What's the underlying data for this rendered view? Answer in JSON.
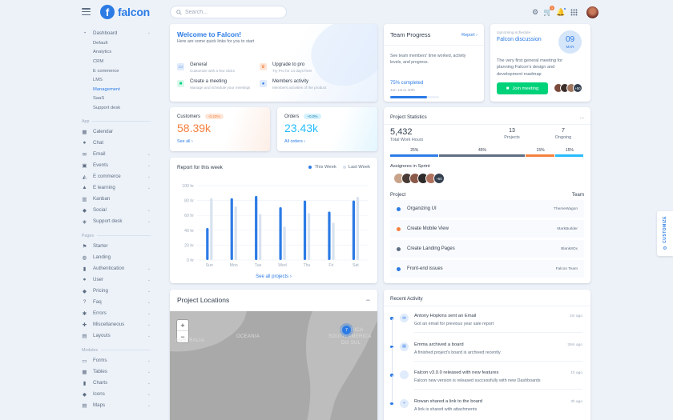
{
  "header": {
    "logo": "falcon",
    "search_placeholder": "Search...",
    "cart_count": "1"
  },
  "sidebar": {
    "dashboard": {
      "label": "Dashboard",
      "children": [
        "Default",
        "Analytics",
        "CRM",
        "E commerce",
        "LMS",
        "Management",
        "SaaS",
        "Support desk"
      ],
      "active_index": 5
    },
    "app_label": "App",
    "app": [
      {
        "label": "Calendar",
        "icon": "calendar-icon",
        "chevron": false
      },
      {
        "label": "Chat",
        "icon": "chat-icon",
        "chevron": false
      },
      {
        "label": "Email",
        "icon": "envelope-icon",
        "chevron": true
      },
      {
        "label": "Events",
        "icon": "calendar-day-icon",
        "chevron": true
      },
      {
        "label": "E commerce",
        "icon": "cart-icon",
        "chevron": true
      },
      {
        "label": "E learning",
        "icon": "graduation-cap-icon",
        "chevron": true
      },
      {
        "label": "Kanban",
        "icon": "kanban-icon",
        "chevron": false
      },
      {
        "label": "Social",
        "icon": "share-icon",
        "chevron": true
      },
      {
        "label": "Support desk",
        "icon": "ticket-icon",
        "chevron": true
      }
    ],
    "pages_label": "Pages",
    "pages": [
      {
        "label": "Starter",
        "icon": "flag-icon",
        "chevron": false
      },
      {
        "label": "Landing",
        "icon": "globe-icon",
        "chevron": false
      },
      {
        "label": "Authentication",
        "icon": "lock-icon",
        "chevron": true
      },
      {
        "label": "User",
        "icon": "user-icon",
        "chevron": true
      },
      {
        "label": "Pricing",
        "icon": "tag-icon",
        "chevron": true
      },
      {
        "label": "Faq",
        "icon": "question-icon",
        "chevron": true
      },
      {
        "label": "Errors",
        "icon": "bug-icon",
        "chevron": true
      },
      {
        "label": "Miscellaneous",
        "icon": "puzzle-icon",
        "chevron": true
      },
      {
        "label": "Layouts",
        "icon": "layout-icon",
        "chevron": true
      }
    ],
    "modules_label": "Modules",
    "modules": [
      {
        "label": "Forms",
        "icon": "file-icon",
        "chevron": true
      },
      {
        "label": "Tables",
        "icon": "table-icon",
        "chevron": true
      },
      {
        "label": "Charts",
        "icon": "chart-icon",
        "chevron": true
      },
      {
        "label": "Icons",
        "icon": "shapes-icon",
        "chevron": true
      },
      {
        "label": "Maps",
        "icon": "map-icon",
        "chevron": true
      }
    ]
  },
  "welcome": {
    "title": "Welcome to Falcon!",
    "subtitle": "Here are some quick links for you to start",
    "links": [
      {
        "title": "General",
        "sub": "Customize with a few clicks",
        "color": "#2c7be5",
        "bg": "#e0ebfb",
        "icon": "doc-icon"
      },
      {
        "title": "Upgrade to pro",
        "sub": "Try Pro for 14 days free!",
        "color": "#f5803e",
        "bg": "#fde6d8",
        "icon": "crown-icon"
      },
      {
        "title": "Create a meeting",
        "sub": "Manage and schedule your meetings",
        "color": "#00d27a",
        "bg": "#d9f8eb",
        "icon": "video-icon"
      },
      {
        "title": "Members activity",
        "sub": "Members activities of the product",
        "color": "#2c7be5",
        "bg": "#e0ebfb",
        "icon": "users-icon"
      }
    ]
  },
  "team_progress": {
    "title": "Team Progress",
    "report_link": "Report",
    "description": "See team members' time worked, activity levels, and progress.",
    "progress": 0.75,
    "completed": "75% completed",
    "date": "Jan 1st to 30th"
  },
  "upcoming": {
    "label": "Upcoming schedule",
    "title": "Falcon discussion",
    "day": "09",
    "month": "MAR",
    "description": "The very first general meeting for planning Falcon's design and development roadmap",
    "button": "Join meeting",
    "more": "+50"
  },
  "customers": {
    "label": "Customers",
    "change": "-0.23%",
    "value": "58.39k",
    "link": "See all",
    "color": "#f5803e"
  },
  "orders": {
    "label": "Orders",
    "change": "+0.0%",
    "value": "23.43k",
    "link": "All orders",
    "color": "#27bcfd"
  },
  "report": {
    "title": "Report for this week",
    "link": "See all projects",
    "this_week_color": "#2c7be5",
    "last_week_color": "#d8e2ef"
  },
  "chart_data": {
    "type": "bar",
    "title": "Report for this week",
    "categories": [
      "Sun",
      "Mon",
      "Tue",
      "Wed",
      "Thu",
      "Fri",
      "Sat"
    ],
    "y_ticks": [
      "100 hr",
      "80 hr",
      "60 hr",
      "40 hr",
      "20 hr",
      "0 hr"
    ],
    "ylim": [
      0,
      100
    ],
    "series": [
      {
        "name": "This Week",
        "values": [
          43,
          83,
          86,
          71,
          80,
          65,
          80
        ]
      },
      {
        "name": "Last Week",
        "values": [
          83,
          72,
          62,
          45,
          63,
          50,
          85
        ]
      }
    ]
  },
  "project_stats": {
    "title": "Project Statistics",
    "menu": "...",
    "total": "5,432",
    "total_label": "Total Work Hours",
    "projects": "13",
    "projects_label": "Projects",
    "ongoing": "7",
    "ongoing_label": "Ongoing",
    "segments": [
      {
        "label": "25%",
        "value": 25,
        "color": "#2c7be5"
      },
      {
        "label": "45%",
        "value": 45,
        "color": "#5e6e82"
      },
      {
        "label": "15%",
        "value": 15,
        "color": "#f5803e"
      },
      {
        "label": "15%",
        "value": 15,
        "color": "#27bcfd"
      }
    ],
    "assignees_label": "Assignees in Sprint",
    "assignees_more": "+50",
    "col_project": "Project",
    "col_team": "Team",
    "projects_list": [
      {
        "name": "Organizing UI",
        "team": "ThemeWagon",
        "color": "#2c7be5"
      },
      {
        "name": "Create Mobile View",
        "team": "MarkBuilder",
        "color": "#f5803e"
      },
      {
        "name": "Create Landing Pages",
        "team": "Blank8Ox",
        "color": "#5e6e82"
      },
      {
        "name": "Front-end issues",
        "team": "Falcon Team",
        "color": "#2c7be5"
      }
    ]
  },
  "locations": {
    "title": "Project Locations",
    "menu": "−",
    "labels": [
      "AUSTRALIA",
      "OCEANIA",
      "AMÉRICA",
      "DO SUL",
      "SOUTH AMERICA"
    ],
    "cluster": "7"
  },
  "activity": {
    "title": "Recent Activity",
    "items": [
      {
        "title": "Antony Hopkins sent an Email",
        "sub": "Got an email for previous year sale report",
        "time": "2m ago",
        "icon": "envelope-icon",
        "glyph": "✉"
      },
      {
        "title": "Emma archived a board",
        "sub": "A finished project's board is archived recently",
        "time": "26m ago",
        "icon": "archive-icon",
        "glyph": "▤"
      },
      {
        "title": "Falcon v3.0.0 released with new features",
        "sub": "Falcon new version is released successfully with new Dashboards",
        "time": "1h ago",
        "icon": "code-icon",
        "glyph": "</>"
      },
      {
        "title": "Rowan shared a link to the board",
        "sub": "A link is shared with attachments",
        "time": "3h ago",
        "icon": "link-icon",
        "glyph": "⑂"
      }
    ]
  },
  "customize": {
    "label": "CUSTOMIZE"
  }
}
